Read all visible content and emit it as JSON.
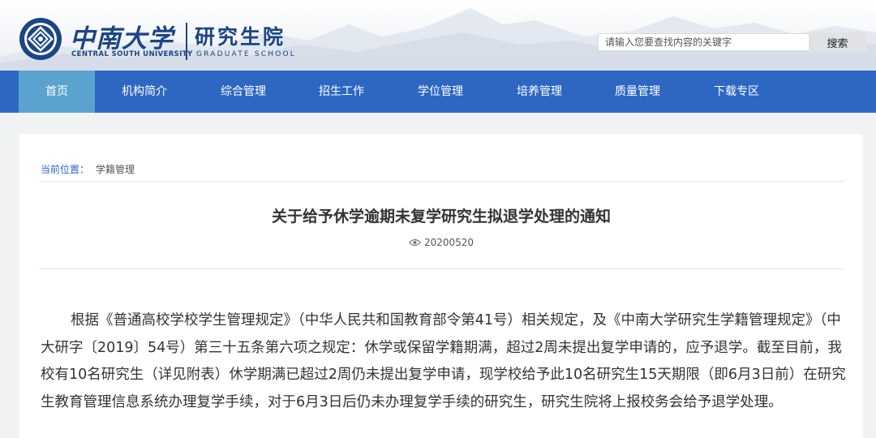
{
  "header": {
    "university_cn": "中南大学",
    "university_en": "CENTRAL SOUTH UNIVERSITY",
    "school_cn": "研究生院",
    "school_en": "GRADUATE SCHOOL",
    "search_placeholder": "请输入您要查找内容的关键字",
    "search_button": "搜索"
  },
  "nav": {
    "items": [
      {
        "label": "首页",
        "active": true
      },
      {
        "label": "机构简介"
      },
      {
        "label": "综合管理"
      },
      {
        "label": "招生工作"
      },
      {
        "label": "学位管理"
      },
      {
        "label": "培养管理"
      },
      {
        "label": "质量管理"
      },
      {
        "label": "下载专区"
      }
    ]
  },
  "breadcrumb": {
    "label": "当前位置：",
    "current": "学籍管理"
  },
  "article": {
    "title": "关于给予休学逾期未复学研究生拟退学处理的通知",
    "date": "20200520",
    "paragraph": "根据《普通高校学校学生管理规定》（中华人民共和国教育部令第41号）相关规定，及《中南大学研究生学籍管理规定》（中大研字〔2019〕54号）第三十五条第六项之规定：休学或保留学籍期满，超过2周未提出复学申请的，应予退学。截至目前，我校有10名研究生（详见附表）休学期满已超过2周仍未提出复学申请，现学校给予此10名研究生15天期限（即6月3日前）在研究生教育管理信息系统办理复学手续，对于6月3日后仍未办理复学手续的研究生，研究生院将上报校务会给予退学处理。"
  },
  "colors": {
    "nav_bg": "#2d67c2",
    "nav_active": "#5aa3cf",
    "brand": "#1b4585"
  }
}
